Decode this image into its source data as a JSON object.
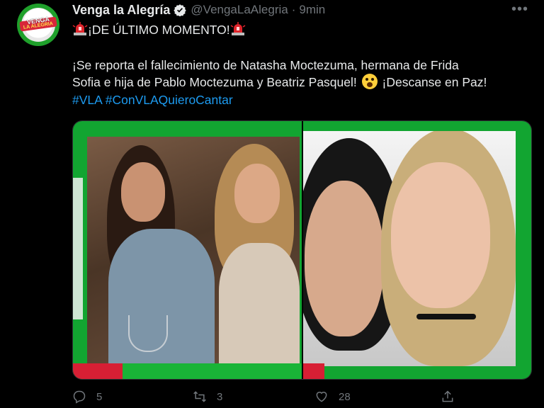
{
  "account": {
    "display_name": "Venga la Alegría",
    "handle": "@VengaLaAlegria",
    "separator": "·",
    "time": "9min",
    "avatar_text_top": "VENGA",
    "avatar_text_bottom": "LA ALEGRIA"
  },
  "tweet": {
    "line1": "¡DE ÚLTIMO MOMENTO!",
    "line2": "¡Se reporta el fallecimiento de Natasha Moctezuma, hermana de Frida",
    "line3_a": "Sofia e hija de Pablo Moctezuma y Beatriz Pasquel!",
    "line3_b": "¡Descanse en Paz!",
    "hashtag1": "#VLA",
    "hashtag2": "#ConVLAQuieroCantar"
  },
  "actions": {
    "replies": "5",
    "retweets": "3",
    "likes": "28"
  },
  "colors": {
    "background": "#000000",
    "text": "#e7e9ea",
    "muted": "#71767b",
    "link": "#1d9bf0",
    "brand_green": "#12a531",
    "brand_red": "#d71f34"
  },
  "icons": [
    "verified-badge-icon",
    "more-icon",
    "siren-emoji-icon",
    "screaming-face-emoji-icon",
    "reply-icon",
    "retweet-icon",
    "like-icon",
    "share-icon"
  ]
}
